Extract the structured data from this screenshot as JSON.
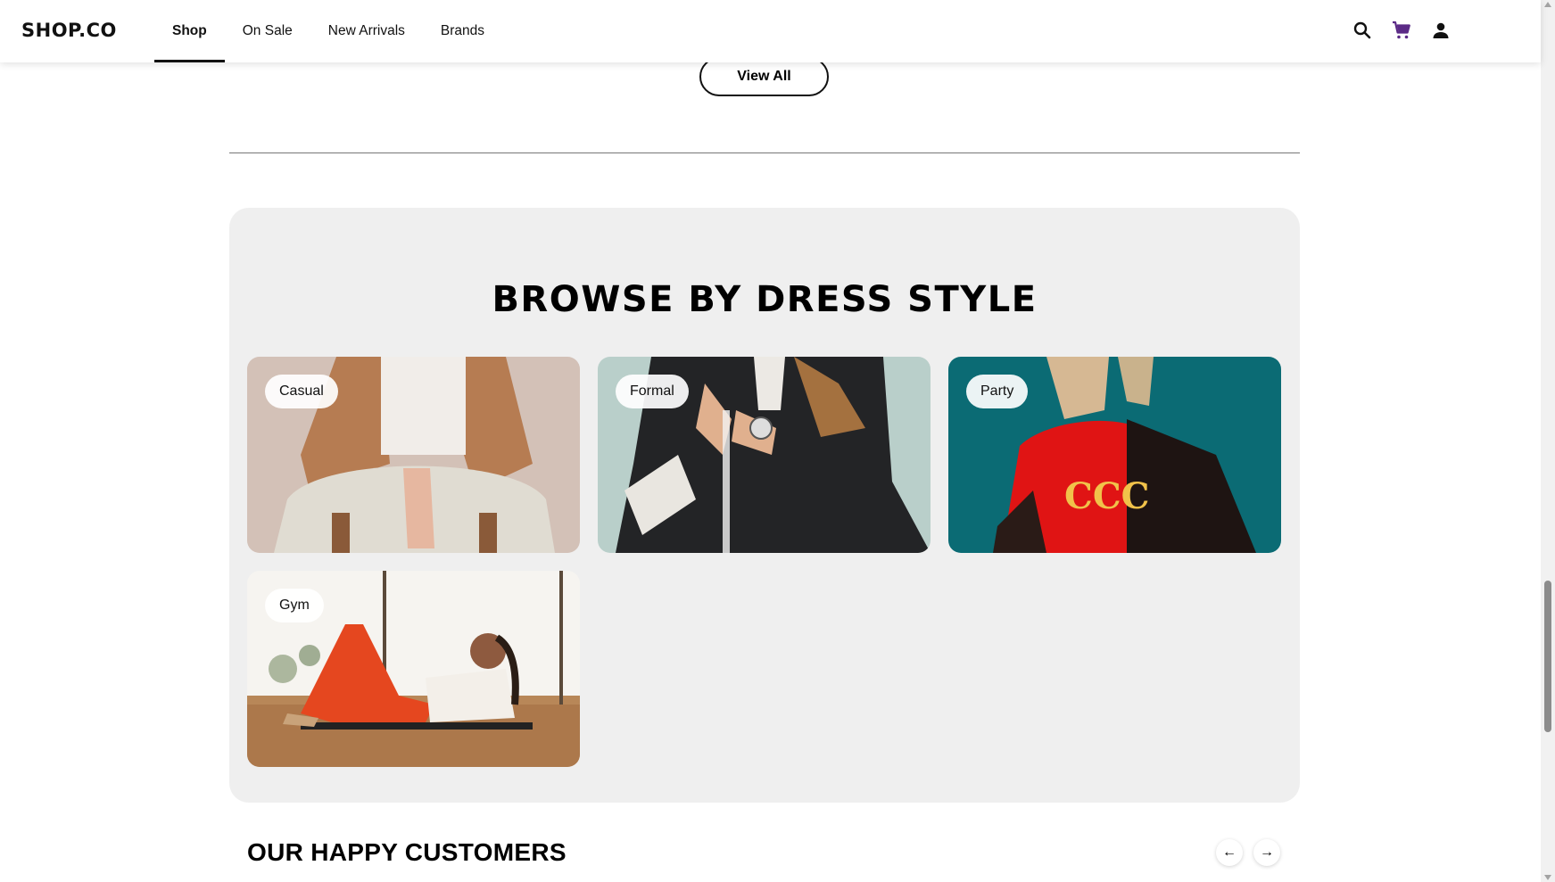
{
  "header": {
    "logo": "SHOP.CO",
    "nav": [
      {
        "label": "Shop",
        "active": true
      },
      {
        "label": "On Sale"
      },
      {
        "label": "New Arrivals"
      },
      {
        "label": "Brands"
      }
    ],
    "icons": [
      "search-icon",
      "cart-icon",
      "account-icon"
    ],
    "cart_color": "#5b2a86"
  },
  "view_all": {
    "label": "View All"
  },
  "browse": {
    "title": "BROWSE BY DRESS STYLE",
    "cards": [
      {
        "label": "Casual"
      },
      {
        "label": "Formal"
      },
      {
        "label": "Party"
      },
      {
        "label": "Gym"
      }
    ]
  },
  "customers": {
    "title": "OUR HAPPY CUSTOMERS",
    "prev": "←",
    "next": "→"
  }
}
